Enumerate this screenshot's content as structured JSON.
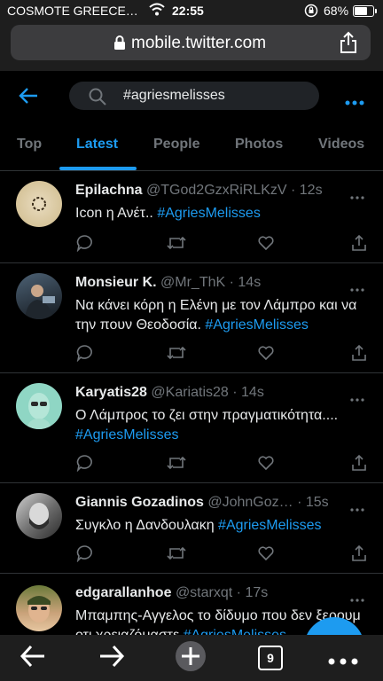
{
  "status_bar": {
    "carrier": "COSMOTE GREECE…",
    "time": "22:55",
    "battery_pct": "68%",
    "battery_level": 0.68
  },
  "browser": {
    "url": "mobile.twitter.com"
  },
  "search": {
    "query": "#agriesmelisses"
  },
  "tabs": [
    {
      "label": "Top",
      "active": false
    },
    {
      "label": "Latest",
      "active": true
    },
    {
      "label": "People",
      "active": false
    },
    {
      "label": "Photos",
      "active": false
    },
    {
      "label": "Videos",
      "active": false
    }
  ],
  "tweets": [
    {
      "name": "Epilachna",
      "handle": "@TGod2GzxRiRLKzV",
      "time": "12s",
      "text": "Icon η Ανέτ..  ",
      "hashtag": "#AgriesMelisses"
    },
    {
      "name": "Monsieur K.",
      "handle": "@Mr_ThK",
      "time": "14s",
      "text": "Να κάνει κόρη η Ελένη με τον Λάμπρο και να την πουν Θεοδοσία. ",
      "hashtag": "#AgriesMelisses"
    },
    {
      "name": "Karyatis28",
      "handle": "@Kariatis28",
      "time": "14s",
      "text": "Ο Λάμπρος το ζει στην πραγματικότητα.... ",
      "hashtag": "#AgriesMelisses"
    },
    {
      "name": "Giannis Gozadinos",
      "handle": "@JohnGoz…",
      "time": "15s",
      "text": "Συγκλο η Δανδουλακη ",
      "hashtag": "#AgriesMelisses"
    },
    {
      "name": "edgarallanhoe",
      "handle": "@starxqt",
      "time": "17s",
      "text": "Μπαμπης-Αγγελος το δίδυμο που δεν ξερουμ οτι χρειαζόμαστε ",
      "hashtag": "#AgriesMelisses"
    }
  ],
  "bottom_bar": {
    "tab_count": "9"
  },
  "colors": {
    "accent": "#1d9bf0",
    "background": "#000000",
    "muted": "#71767b",
    "divider": "#2f3336"
  }
}
